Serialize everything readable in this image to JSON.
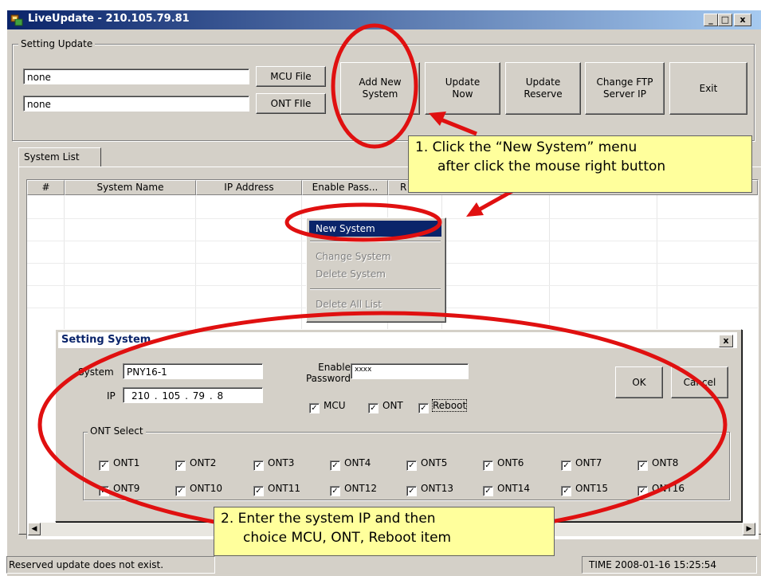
{
  "window": {
    "title": "LiveUpdate - 210.105.79.81",
    "controls": [
      "_",
      "□",
      "x"
    ]
  },
  "setting_update": {
    "legend": "Setting Update",
    "mcu_file_value": "none",
    "ont_file_value": "none",
    "mcu_file_button": "MCU File",
    "ont_file_button": "ONT FIle",
    "buttons": {
      "add_new_system": [
        "Add New",
        "System"
      ],
      "update_now": [
        "Update",
        "Now"
      ],
      "update_reserve": [
        "Update",
        "Reserve"
      ],
      "change_ftp": [
        "Change FTP",
        "Server IP"
      ],
      "exit": "Exit"
    }
  },
  "tab": {
    "label": "System List"
  },
  "list": {
    "columns": [
      "#",
      "System Name",
      "IP Address",
      "Enable Pass...",
      "R"
    ]
  },
  "context_menu": {
    "items": [
      {
        "label": "New System",
        "enabled": true
      },
      {
        "label": "Change System",
        "enabled": false
      },
      {
        "label": "Delete System",
        "enabled": false
      },
      {
        "label": "Delete All List",
        "enabled": false
      }
    ]
  },
  "dialog": {
    "title": "Setting System",
    "close": "x",
    "system_label": "System",
    "system_value": "PNY16-1",
    "ip_label": "IP",
    "ip_octets": [
      "210",
      "105",
      "79",
      "8"
    ],
    "enable_password_label": [
      "Enable",
      "Password"
    ],
    "enable_password_value": "xxxx",
    "checks": {
      "mcu": "MCU",
      "ont": "ONT",
      "reboot": "Reboot"
    },
    "ok": "OK",
    "cancel": "Cancel",
    "ont_select_legend": "ONT Select",
    "onts": [
      "ONT1",
      "ONT2",
      "ONT3",
      "ONT4",
      "ONT5",
      "ONT6",
      "ONT7",
      "ONT8",
      "ONT9",
      "ONT10",
      "ONT11",
      "ONT12",
      "ONT13",
      "ONT14",
      "ONT15",
      "ONT16"
    ]
  },
  "callouts": {
    "one": [
      "1. Click the “New System” menu",
      "after click the mouse right button"
    ],
    "two": [
      "2. Enter the system IP and then",
      "choice MCU, ONT, Reboot item"
    ]
  },
  "status": {
    "left": "Reserved update does not exist.",
    "right": "TIME 2008-01-16 15:25:54"
  },
  "colors": {
    "titlebar": "#0a246a",
    "highlight": "#0a246a",
    "callout_bg": "#ffff9c",
    "annotation": "#e01010"
  }
}
